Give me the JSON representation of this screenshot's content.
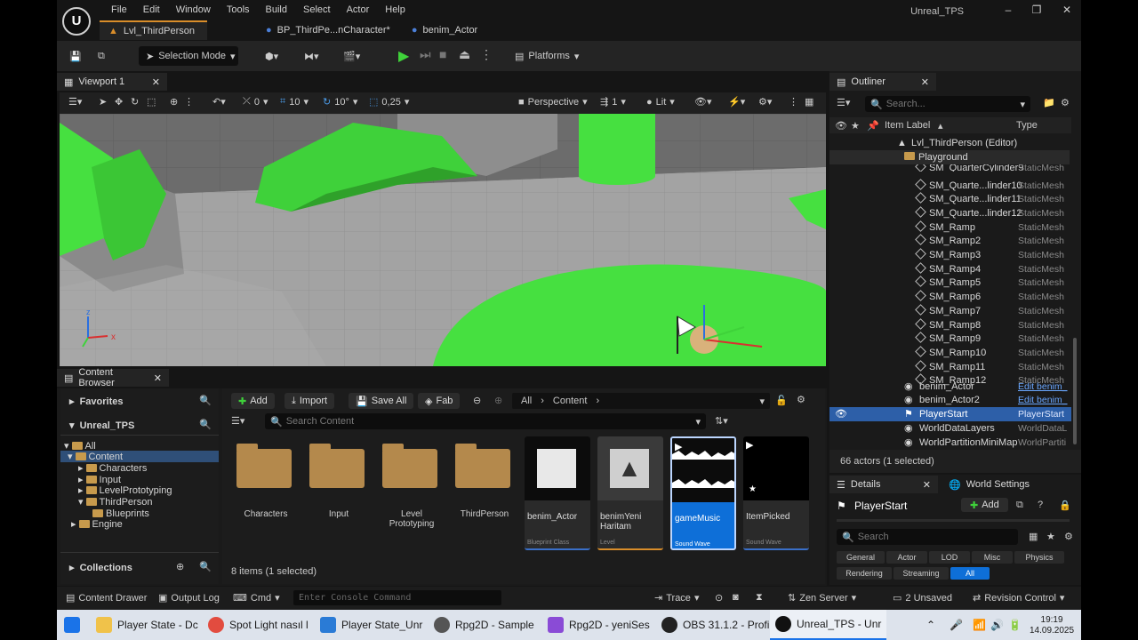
{
  "app": {
    "title": "Unreal_TPS",
    "logo": "U"
  },
  "menu": [
    "File",
    "Edit",
    "Window",
    "Tools",
    "Build",
    "Select",
    "Actor",
    "Help"
  ],
  "doc_tabs": [
    {
      "label": "Lvl_ThirdPerson",
      "active": true
    },
    {
      "label": "BP_ThirdPe...nCharacter*",
      "active": false
    },
    {
      "label": "benim_Actor",
      "active": false
    }
  ],
  "toolbar": {
    "selection_mode": "Selection Mode",
    "platforms": "Platforms"
  },
  "viewport": {
    "tab": "Viewport 1",
    "snap_move": "0",
    "grid": "10",
    "angle": "10°",
    "scale": "0,25",
    "perspective": "Perspective",
    "cam_speed": "1",
    "lit": "Lit",
    "axis_x": "x",
    "axis_z": "z"
  },
  "content_browser": {
    "tab": "Content Browser",
    "favorites": "Favorites",
    "project": "Unreal_TPS",
    "collections": "Collections",
    "add": "Add",
    "import": "Import",
    "save_all": "Save All",
    "fab": "Fab",
    "path": [
      "All",
      "Content"
    ],
    "search_placeholder": "Search Content",
    "item_count": "8 items (1 selected)",
    "tree": [
      "All",
      "Content",
      "Characters",
      "Input",
      "LevelPrototyping",
      "ThirdPerson",
      "Blueprints",
      "Engine"
    ],
    "folders": [
      "Characters",
      "Input",
      "Level\nPrototyping",
      "ThirdPerson"
    ],
    "assets": [
      {
        "name": "benim_Actor",
        "type": "Blueprint Class"
      },
      {
        "name": "benimYeni\nHaritam",
        "type": "Level"
      },
      {
        "name": "gameMusic",
        "type": "Sound Wave"
      },
      {
        "name": "ItemPicked",
        "type": "Sound Wave"
      }
    ]
  },
  "outliner": {
    "tab": "Outliner",
    "search_placeholder": "Search...",
    "col_label": "Item Label",
    "col_type": "Type",
    "level": "Lvl_ThirdPerson (Editor)",
    "folder": "Playground",
    "rows": [
      {
        "label": "SM_QuarterCylinder9",
        "type": "StaticMesh"
      },
      {
        "label": "SM_Quarte...linder10",
        "type": "StaticMesh"
      },
      {
        "label": "SM_Quarte...linder11",
        "type": "StaticMesh"
      },
      {
        "label": "SM_Quarte...linder12",
        "type": "StaticMesh"
      },
      {
        "label": "SM_Ramp",
        "type": "StaticMesh"
      },
      {
        "label": "SM_Ramp2",
        "type": "StaticMesh"
      },
      {
        "label": "SM_Ramp3",
        "type": "StaticMesh"
      },
      {
        "label": "SM_Ramp4",
        "type": "StaticMesh"
      },
      {
        "label": "SM_Ramp5",
        "type": "StaticMesh"
      },
      {
        "label": "SM_Ramp6",
        "type": "StaticMesh"
      },
      {
        "label": "SM_Ramp7",
        "type": "StaticMesh"
      },
      {
        "label": "SM_Ramp8",
        "type": "StaticMesh"
      },
      {
        "label": "SM_Ramp9",
        "type": "StaticMesh"
      },
      {
        "label": "SM_Ramp10",
        "type": "StaticMesh"
      },
      {
        "label": "SM_Ramp11",
        "type": "StaticMesh"
      },
      {
        "label": "SM_Ramp12",
        "type": "StaticMesh"
      }
    ],
    "actors": [
      {
        "label": "benim_Actor",
        "type": "Edit benim_"
      },
      {
        "label": "benim_Actor2",
        "type": "Edit benim_"
      },
      {
        "label": "PlayerStart",
        "type": "PlayerStart"
      },
      {
        "label": "WorldDataLayers",
        "type": "WorldDataL"
      },
      {
        "label": "WorldPartitionMiniMap",
        "type": "WorldPartiti"
      }
    ],
    "count": "66 actors (1 selected)"
  },
  "details": {
    "tab": "Details",
    "tab2": "World Settings",
    "selected": "PlayerStart",
    "add": "Add",
    "search_placeholder": "Search",
    "filters": [
      "General",
      "Actor",
      "LOD",
      "Misc",
      "Physics",
      "Rendering",
      "Streaming",
      "All"
    ]
  },
  "statusbar": {
    "content_drawer": "Content Drawer",
    "output_log": "Output Log",
    "cmd": "Cmd",
    "console_placeholder": "Enter Console Command",
    "trace": "Trace",
    "zen": "Zen Server",
    "unsaved": "2 Unsaved",
    "revision": "Revision Control"
  },
  "taskbar": {
    "items": [
      "Player State - Dc",
      "Spot Light nasıl l",
      "Player State_Unr",
      "Rpg2D - Sample",
      "Rpg2D - yeniSes",
      "OBS 31.1.2 - Profi",
      "Unreal_TPS - Unr"
    ],
    "time": "19:19",
    "date": "14.09.2025"
  },
  "colors": {
    "accent_orange": "#d98d2a",
    "selection_blue": "#0e6fd8",
    "green_mesh": "#43e03a"
  }
}
